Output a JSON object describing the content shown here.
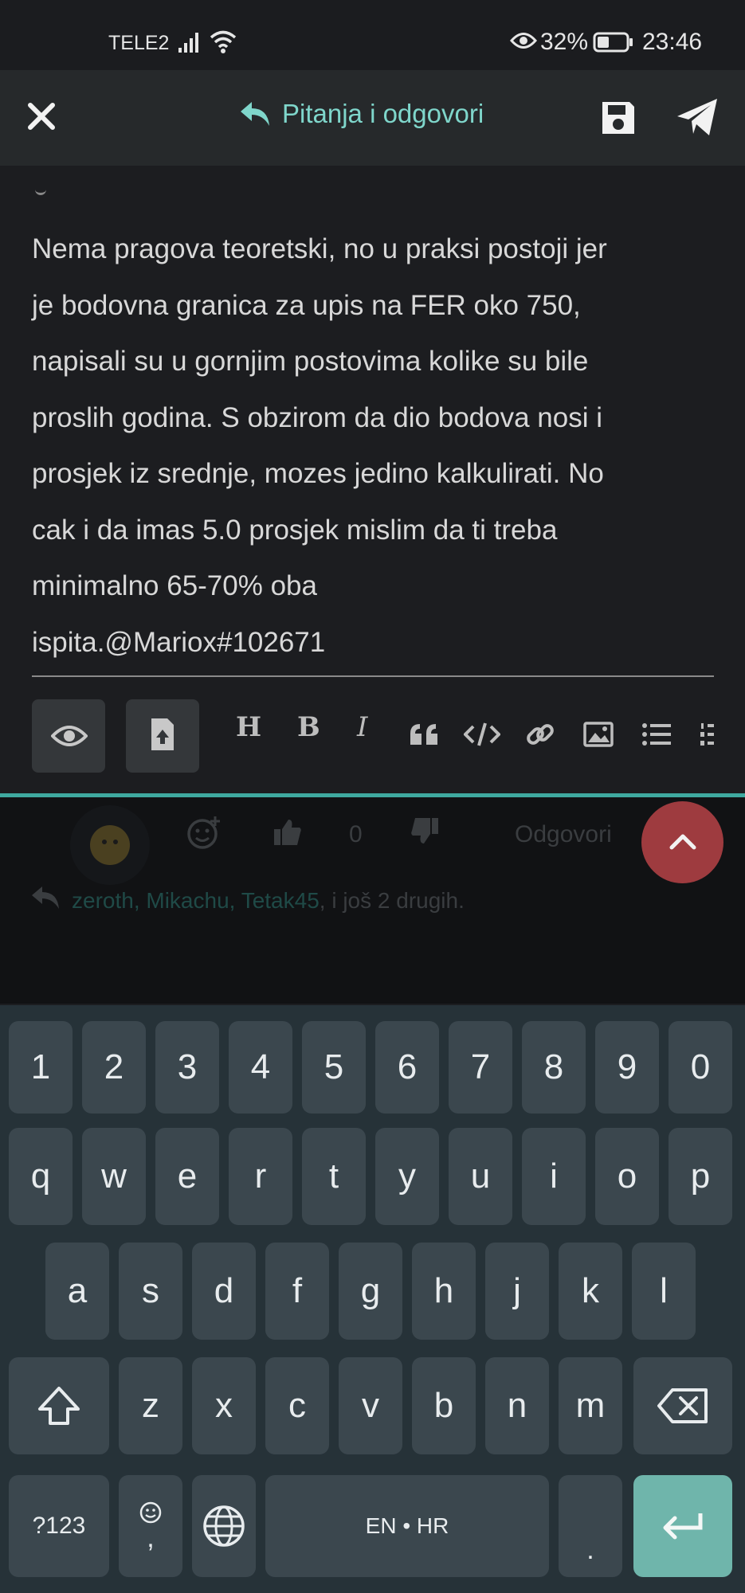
{
  "status_bar": {
    "carrier": "TELE2",
    "battery_percent": "32%",
    "time": "23:46"
  },
  "header": {
    "title": "Pitanja i odgovori"
  },
  "editor": {
    "lines": [
      "Nema pragova teoretski, no u praksi postoji jer",
      "je bodovna granica za upis na FER oko 750,",
      "napisali su u gornjim postovima kolike su bile",
      "proslih godina. S obzirom da dio bodova nosi i",
      "prosjek iz srednje, mozes jedino kalkulirati. No",
      "cak i da imas 5.0 prosjek mislim da ti treba",
      "minimalno 65-70% oba",
      "ispita.@Mariox#102671"
    ]
  },
  "toolbar": {
    "heading": "H",
    "bold": "B",
    "italic": "I"
  },
  "post_actions": {
    "like_count": "0",
    "reply_label": "Odgovori",
    "reply_names": "zeroth, Mikachu, Tetak45",
    "reply_more": ", i još 2 drugih."
  },
  "keyboard": {
    "row1": [
      "1",
      "2",
      "3",
      "4",
      "5",
      "6",
      "7",
      "8",
      "9",
      "0"
    ],
    "row2": [
      "q",
      "w",
      "e",
      "r",
      "t",
      "y",
      "u",
      "i",
      "o",
      "p"
    ],
    "row3": [
      "a",
      "s",
      "d",
      "f",
      "g",
      "h",
      "j",
      "k",
      "l"
    ],
    "row4": [
      "z",
      "x",
      "c",
      "v",
      "b",
      "n",
      "m"
    ],
    "symbols_key": "?123",
    "comma_key": ",",
    "space_label": "EN • HR",
    "period_key": "."
  },
  "colors": {
    "accent": "#7fd6cb",
    "fab": "#9e3b3f",
    "keyboard_bg": "#263238",
    "key_bg": "#3b474e",
    "enter_bg": "#6fb5ab"
  }
}
